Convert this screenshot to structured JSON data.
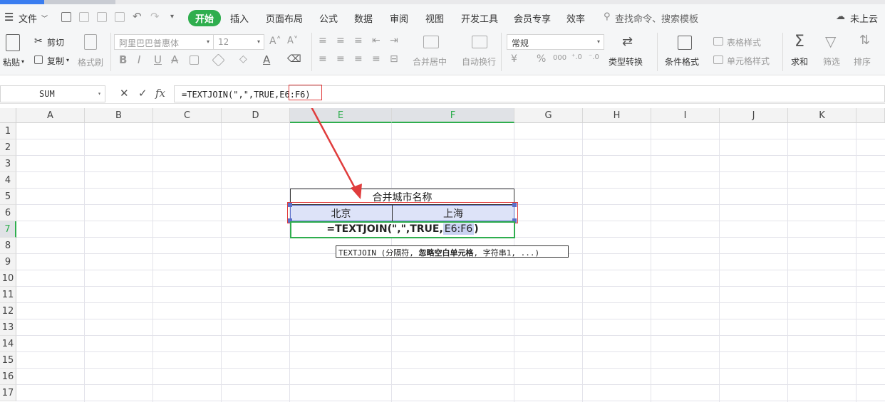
{
  "menu": {
    "file": "文件",
    "tabs": [
      "开始",
      "插入",
      "页面布局",
      "公式",
      "数据",
      "审阅",
      "视图",
      "开发工具",
      "会员专享",
      "效率"
    ],
    "search": "查找命令、搜索模板",
    "cloud": "未上云"
  },
  "ribbon": {
    "paste": "粘贴",
    "cut": "剪切",
    "copy": "复制",
    "format_painter": "格式刷",
    "font_name": "阿里巴巴普惠体",
    "font_size": "12",
    "merge_center": "合并居中",
    "wrap_text": "自动换行",
    "number_format": "常规",
    "type_convert": "类型转换",
    "cond_format": "条件格式",
    "table_style": "表格样式",
    "cell_style": "单元格样式",
    "sum": "求和",
    "filter": "筛选",
    "sort": "排序"
  },
  "formula_bar": {
    "name_box": "SUM",
    "fx": "fx",
    "formula": "=TEXTJOIN(\",\",TRUE,E6:F6)"
  },
  "columns": [
    "A",
    "B",
    "C",
    "D",
    "E",
    "F",
    "G",
    "H",
    "I",
    "J",
    "K"
  ],
  "rows": [
    "1",
    "2",
    "3",
    "4",
    "5",
    "6",
    "7",
    "8",
    "9",
    "10",
    "11",
    "12",
    "13",
    "14",
    "15",
    "16",
    "17"
  ],
  "cells": {
    "E5": "合并城市名称",
    "E6": "北京",
    "F6": "上海",
    "E7_prefix": "=TEXTJOIN(\",\",TRUE,",
    "E7_ref": "E6:F6",
    "E7_suffix": ")"
  },
  "tooltip": {
    "prefix": "TEXTJOIN (分隔符, ",
    "bold": "忽略空白单元格",
    "suffix": ", 字符串1, ...)"
  },
  "colors": {
    "accent": "#2fae4e",
    "annotation": "#e03c3c",
    "range_fill": "#dde3f8"
  }
}
